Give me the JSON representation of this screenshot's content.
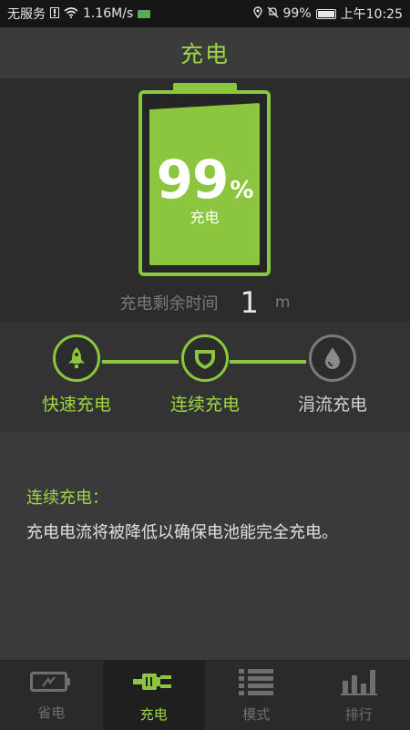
{
  "status_bar": {
    "carrier": "无服务",
    "speed": "1.16M/s",
    "battery": "99%",
    "time": "上午10:25"
  },
  "header": {
    "title": "充电"
  },
  "battery": {
    "level": 99,
    "level_text": "99",
    "unit": "%",
    "state": "充电"
  },
  "remaining": {
    "label": "充电剩余时间",
    "value": "1",
    "unit": "m"
  },
  "modes": [
    {
      "label": "快速充电",
      "icon": "rocket-icon",
      "active": true
    },
    {
      "label": "连续充电",
      "icon": "shield-icon",
      "active": true
    },
    {
      "label": "涓流充电",
      "icon": "drop-icon",
      "active": false
    }
  ],
  "description": {
    "title": "连续充电：",
    "body": "充电电流将被降低以确保电池能完全充电。"
  },
  "tabs": [
    {
      "label": "省电",
      "icon": "battery-save-icon",
      "active": false
    },
    {
      "label": "充电",
      "icon": "charger-plug-icon",
      "active": true
    },
    {
      "label": "模式",
      "icon": "list-icon",
      "active": false
    },
    {
      "label": "排行",
      "icon": "bar-chart-icon",
      "active": false
    }
  ],
  "colors": {
    "accent": "#8cc63f",
    "inactive": "#7b7b7b"
  }
}
